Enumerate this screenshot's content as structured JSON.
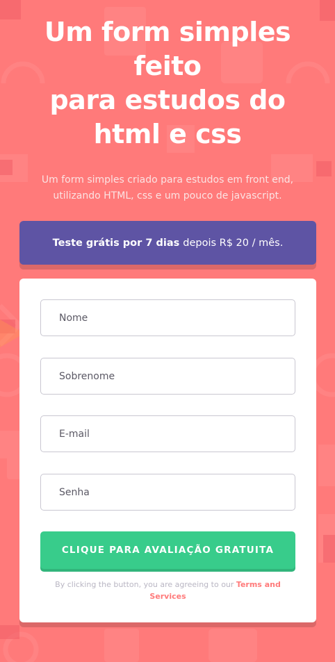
{
  "hero": {
    "title_line1": "Um form simples",
    "title_line2": "feito",
    "title_line3": "para estudos do",
    "title_line4": "html e css",
    "subtitle": "Um form simples criado para estudos em front end, utilizando HTML, css e um pouco de javascript."
  },
  "trial": {
    "bold": "Teste grátis por 7 dias",
    "rest": "depois R$ 20 / mês."
  },
  "form": {
    "fields": [
      {
        "placeholder": "Nome",
        "value": ""
      },
      {
        "placeholder": "Sobrenome",
        "value": ""
      },
      {
        "placeholder": "E-mail",
        "value": ""
      },
      {
        "placeholder": "Senha",
        "value": ""
      }
    ],
    "submit_label": "CLIQUE PARA AVALIAÇÃO GRATUITA",
    "terms_prefix": "By clicking the button, you are agreeing to our",
    "terms_link": "Terms and Services"
  },
  "colors": {
    "background": "#ff7a7a",
    "banner": "#5e54a4",
    "button": "#38cc8b",
    "link": "#ff7a7a"
  },
  "icons": [
    "headset-icon",
    "toolbox-icon",
    "gear-icon",
    "phone-icon",
    "flag-icon",
    "chart-icon"
  ]
}
